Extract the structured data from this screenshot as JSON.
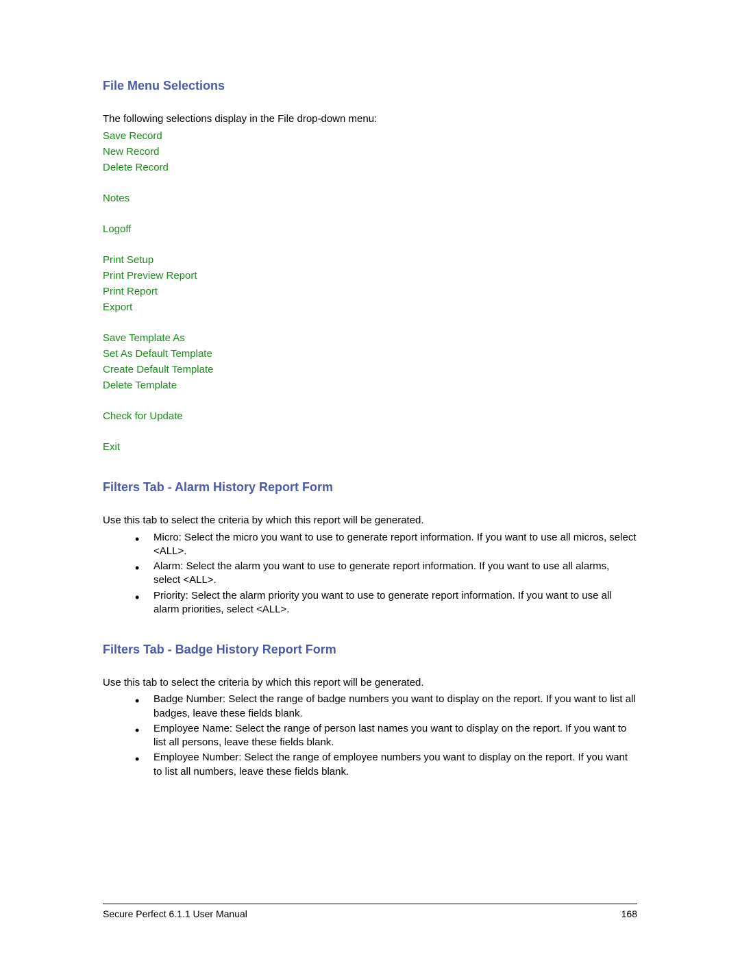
{
  "section1": {
    "heading": "File Menu Selections",
    "intro": "The following selections display in the File drop-down menu:",
    "links": {
      "save_record": "Save Record",
      "new_record": "New Record",
      "delete_record": "Delete Record",
      "notes": "Notes",
      "logoff": "Logoff",
      "print_setup": "Print Setup",
      "print_preview_report": "Print Preview Report",
      "print_report": "Print Report",
      "export": "Export",
      "save_template_as": "Save Template As",
      "set_as_default_template": "Set As Default Template",
      "create_default_template": "Create Default Template",
      "delete_template": "Delete Template",
      "check_for_update": "Check for Update",
      "exit": "Exit"
    }
  },
  "section2": {
    "heading": "Filters Tab - Alarm History Report Form",
    "intro": "Use this tab to select the criteria by which this report will be generated.",
    "bullets": {
      "b1": "Micro: Select the micro you want to use to generate report information. If you want to use all micros, select <ALL>.",
      "b2": "Alarm: Select the alarm you want to use to generate report information. If you want to use all alarms, select <ALL>.",
      "b3": "Priority: Select the alarm priority you want to use to generate report information. If you want to use all alarm priorities, select <ALL>."
    }
  },
  "section3": {
    "heading": "Filters Tab - Badge History Report Form",
    "intro": "Use this tab to select the criteria by which this report will be generated.",
    "bullets": {
      "b1": "Badge Number: Select the range of badge numbers you want to display on the report. If you want to list all badges, leave these fields blank.",
      "b2": "Employee Name: Select the range of person last names you want to display on the report. If you want to list all persons, leave these fields blank.",
      "b3": "Employee Number: Select the range of employee numbers you want to display on the report. If you want to list all numbers, leave these fields blank."
    }
  },
  "footer": {
    "left": "Secure Perfect 6.1.1 User Manual",
    "right": "168"
  }
}
